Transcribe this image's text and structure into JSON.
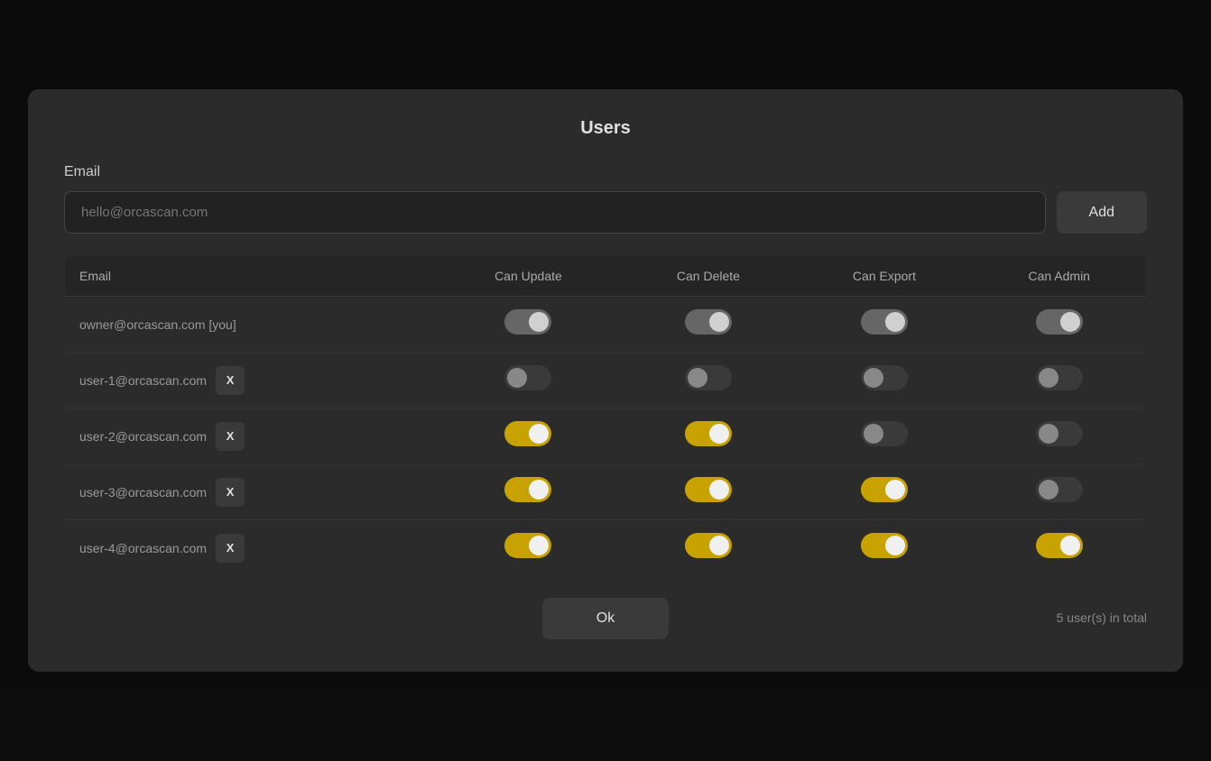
{
  "modal": {
    "title": "Users",
    "email_label": "Email",
    "email_placeholder": "hello@orcascan.com",
    "add_button_label": "Add",
    "ok_button_label": "Ok",
    "user_count_text": "5 user(s) in total"
  },
  "table": {
    "columns": {
      "email": "Email",
      "can_update": "Can Update",
      "can_delete": "Can Delete",
      "can_export": "Can Export",
      "can_admin": "Can Admin"
    },
    "rows": [
      {
        "email": "owner@orcascan.com [you]",
        "is_owner": true,
        "delete_label": "",
        "can_update": "owner-on",
        "can_delete": "owner-on",
        "can_export": "owner-on",
        "can_admin": "owner-on"
      },
      {
        "email": "user-1@orcascan.com",
        "is_owner": false,
        "delete_label": "X",
        "can_update": "off-dark",
        "can_delete": "off-dark",
        "can_export": "off-dark",
        "can_admin": "off-dark"
      },
      {
        "email": "user-2@orcascan.com",
        "is_owner": false,
        "delete_label": "X",
        "can_update": "on-yellow",
        "can_delete": "on-yellow",
        "can_export": "off-dark",
        "can_admin": "off-dark"
      },
      {
        "email": "user-3@orcascan.com",
        "is_owner": false,
        "delete_label": "X",
        "can_update": "on-yellow",
        "can_delete": "on-yellow",
        "can_export": "on-yellow",
        "can_admin": "off-dark"
      },
      {
        "email": "user-4@orcascan.com",
        "is_owner": false,
        "delete_label": "X",
        "can_update": "on-yellow",
        "can_delete": "on-yellow",
        "can_export": "on-yellow",
        "can_admin": "on-yellow"
      }
    ]
  }
}
